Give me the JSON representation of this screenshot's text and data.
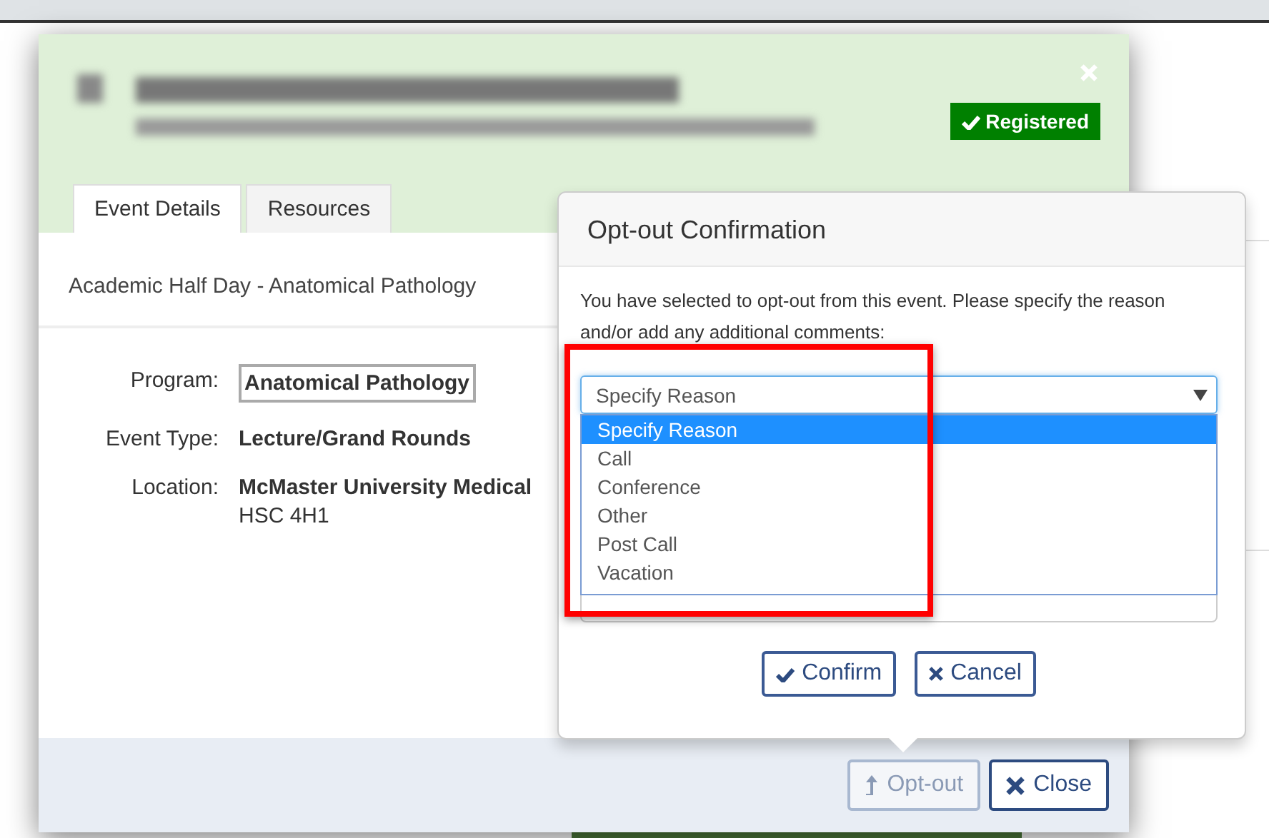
{
  "modal": {
    "status_badge": "Registered",
    "tabs": [
      {
        "label": "Event Details",
        "selected": true
      },
      {
        "label": "Resources",
        "selected": false
      }
    ],
    "subtitle": "Academic Half Day - Anatomical Pathology",
    "fields": [
      {
        "label": "Program:",
        "kind": "boxed",
        "lines": [
          "Anatomical Pathology"
        ]
      },
      {
        "label": "Event Type:",
        "kind": "plain",
        "lines": [
          "Lecture/Grand Rounds"
        ]
      },
      {
        "label": "Location:",
        "kind": "plain",
        "lines": [
          "McMaster University Medical",
          "HSC 4H1"
        ]
      }
    ],
    "footer_buttons": [
      {
        "label": "Opt-out",
        "kind": "optout",
        "disabled": true
      },
      {
        "label": "Close",
        "kind": "close",
        "disabled": false
      }
    ]
  },
  "popover": {
    "title": "Opt-out Confirmation",
    "message": "You have selected to opt-out from this event. Please specify the reason and/or add any additional comments:",
    "select_value": "Specify Reason",
    "options": [
      {
        "label": "Specify Reason",
        "selected": true
      },
      {
        "label": "Call",
        "selected": false
      },
      {
        "label": "Conference",
        "selected": false
      },
      {
        "label": "Other",
        "selected": false
      },
      {
        "label": "Post Call",
        "selected": false
      },
      {
        "label": "Vacation",
        "selected": false
      }
    ],
    "buttons": [
      {
        "label": "Confirm",
        "kind": "confirm"
      },
      {
        "label": "Cancel",
        "kind": "cancel"
      }
    ]
  }
}
